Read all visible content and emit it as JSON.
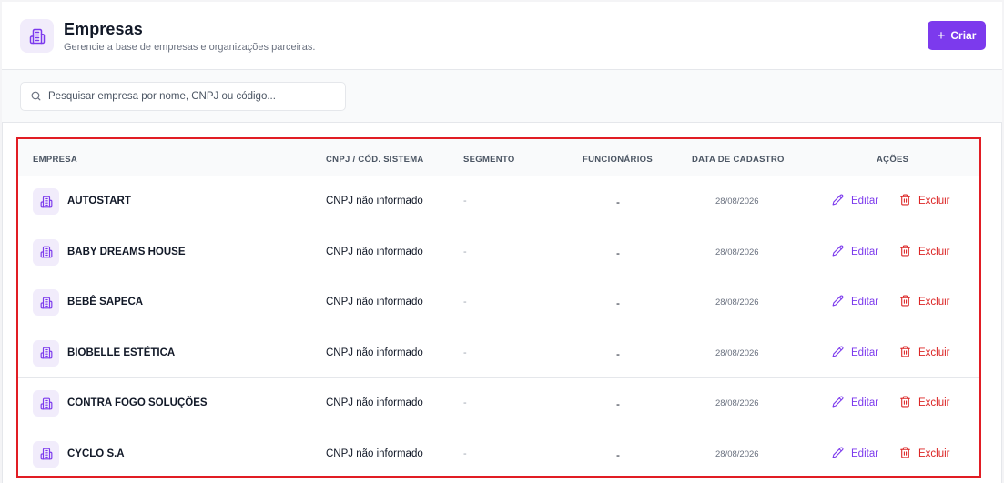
{
  "header": {
    "title": "Empresas",
    "subtitle": "Gerencie a base de empresas e organizações parceiras.",
    "icon": "building-icon",
    "create_label": "Criar"
  },
  "search": {
    "placeholder": "Pesquisar empresa por nome, CNPJ ou código...",
    "value": ""
  },
  "table": {
    "columns": [
      "EMPRESA",
      "CNPJ / CÓD. SISTEMA",
      "SEGMENTO",
      "FUNCIONÁRIOS",
      "DATA DE CADASTRO",
      "AÇÕES"
    ],
    "edit_label": "Editar",
    "delete_label": "Excluir",
    "rows": [
      {
        "name": "AUTOSTART",
        "cnpj": "CNPJ não informado",
        "segment": "-",
        "employees": "-",
        "date": "28/08/2026"
      },
      {
        "name": "BABY DREAMS HOUSE",
        "cnpj": "CNPJ não informado",
        "segment": "-",
        "employees": "-",
        "date": "28/08/2026"
      },
      {
        "name": "BEBÊ SAPECA",
        "cnpj": "CNPJ não informado",
        "segment": "-",
        "employees": "-",
        "date": "28/08/2026"
      },
      {
        "name": "BIOBELLE ESTÉTICA",
        "cnpj": "CNPJ não informado",
        "segment": "-",
        "employees": "-",
        "date": "28/08/2026"
      },
      {
        "name": "CONTRA FOGO SOLUÇÕES",
        "cnpj": "CNPJ não informado",
        "segment": "-",
        "employees": "-",
        "date": "28/08/2026"
      },
      {
        "name": "CYCLO S.A",
        "cnpj": "CNPJ não informado",
        "segment": "-",
        "employees": "-",
        "date": "28/08/2026"
      }
    ]
  },
  "colors": {
    "accent": "#7c3aed",
    "icon_bg": "#f1ecfb",
    "danger": "#dc2626",
    "highlight_border": "#e11d24"
  }
}
